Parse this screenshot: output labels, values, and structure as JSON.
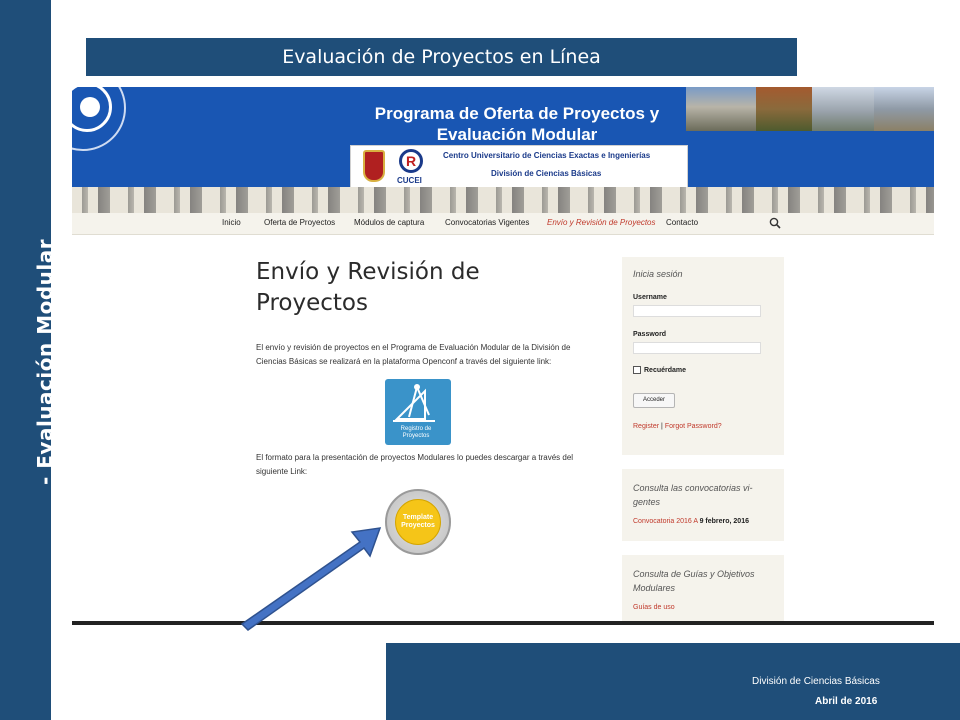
{
  "slide": {
    "banner_title": "Evaluación de Proyectos en Línea",
    "side_label": "- Evaluación Modular",
    "footer_dept": "División de Ciencias Básicas",
    "footer_date": "Abril de 2016"
  },
  "header": {
    "program_title_line1": "Programa de Oferta de Proyectos y",
    "program_title_line2": "Evaluación Modular",
    "cucei_abbr": "CUCEI",
    "centro": "Centro Universitario de Ciencias Exactas e Ingenierías",
    "division": "División de Ciencias Básicas"
  },
  "nav": {
    "items": [
      {
        "label": "Inicio"
      },
      {
        "label": "Oferta de Proyectos"
      },
      {
        "label": "Módulos de captura"
      },
      {
        "label": "Convocatorias Vigentes"
      },
      {
        "label": "Envío y Revisión de Proyectos"
      },
      {
        "label": "Contacto"
      }
    ],
    "active_index": 4,
    "search_icon": "search-icon"
  },
  "main": {
    "title_line1": "Envío y Revisión de",
    "title_line2": "Proyectos",
    "paragraph1": "El envío y revisión de proyectos en el Programa de Evaluación Modular de la División de Ciencias Básicas se realizará en la plataforma Openconf a través del siguiente link:",
    "registro_label_line1": "Registro de",
    "registro_label_line2": "Proyectos",
    "paragraph2": "El formato para la presentación de proyectos Modulares lo puedes descargar a través del siguiente Link:",
    "template_label_line1": "Template",
    "template_label_line2": "Proyectos"
  },
  "sidebar": {
    "login": {
      "title": "Inicia sesión",
      "username_label": "Username",
      "password_label": "Password",
      "remember_label": "Recuérdame",
      "submit_label": "Acceder",
      "register_link": "Register",
      "separator": "|",
      "forgot_link": "Forgot Password?"
    },
    "convocatorias": {
      "title": "Consulta las convocatorias vi-gentes",
      "link": "Convocatoria 2016 A",
      "date": "9 febrero, 2016"
    },
    "guias": {
      "title": "Consulta de Guías y Objetivos Modulares",
      "link": "Guías de uso"
    }
  },
  "colors": {
    "slide_blue": "#1f4e79",
    "site_header_blue": "#1956b3",
    "active_nav_red": "#c0392b",
    "template_yellow": "#f5c518",
    "registro_blue": "#3a93c9"
  }
}
